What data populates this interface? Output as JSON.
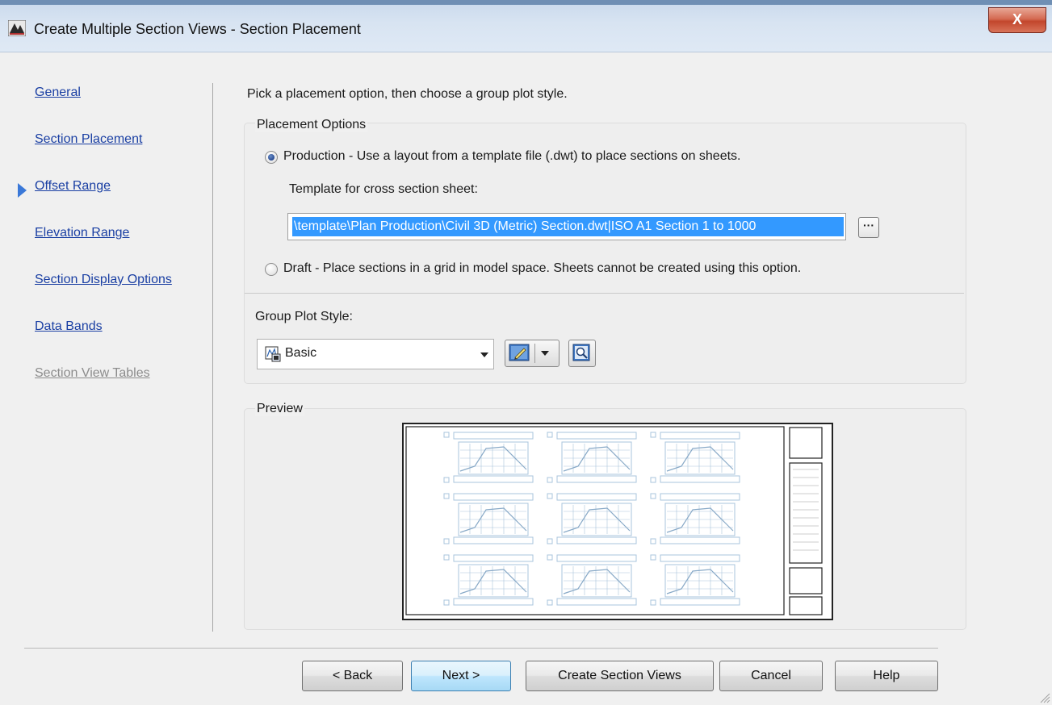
{
  "window": {
    "title": "Create Multiple Section Views - Section Placement",
    "close_label": "X"
  },
  "nav": {
    "items": [
      {
        "label": "General",
        "enabled": true,
        "active": false
      },
      {
        "label": "Section Placement",
        "enabled": true,
        "active": true
      },
      {
        "label": "Offset Range",
        "enabled": true,
        "active": false
      },
      {
        "label": "Elevation Range",
        "enabled": true,
        "active": false
      },
      {
        "label": "Section Display Options",
        "enabled": true,
        "active": false
      },
      {
        "label": "Data Bands",
        "enabled": true,
        "active": false
      },
      {
        "label": "Section View Tables",
        "enabled": false,
        "active": false
      }
    ]
  },
  "main": {
    "instruction": "Pick a placement option, then choose a group plot style.",
    "placement_options": {
      "group_title": "Placement Options",
      "production_label": "Production - Use a layout from a template file (.dwt) to place sections on sheets.",
      "production_checked": true,
      "template_label": "Template for cross section sheet:",
      "template_value": "\\template\\Plan Production\\Civil 3D (Metric) Section.dwt|ISO A1 Section 1 to 1000",
      "browse_label": "···",
      "draft_label": "Draft - Place sections in a grid in model space. Sheets cannot be created using this option.",
      "draft_checked": false
    },
    "group_plot_style": {
      "label": "Group Plot Style:",
      "selected": "Basic"
    },
    "preview": {
      "title": "Preview"
    }
  },
  "buttons": {
    "back": "< Back",
    "next": "Next >",
    "create": "Create Section Views",
    "cancel": "Cancel",
    "help": "Help"
  },
  "icons": {
    "app": "civil3d-app-icon",
    "style": "plot-style-icon",
    "edit": "edit-style-icon",
    "view": "view-style-icon"
  },
  "colors": {
    "link": "#1a3fa3",
    "disabled": "#8c8c8c",
    "selection": "#3399ff",
    "active_arrow": "#3a78d8",
    "close_button": "#c2462c"
  }
}
